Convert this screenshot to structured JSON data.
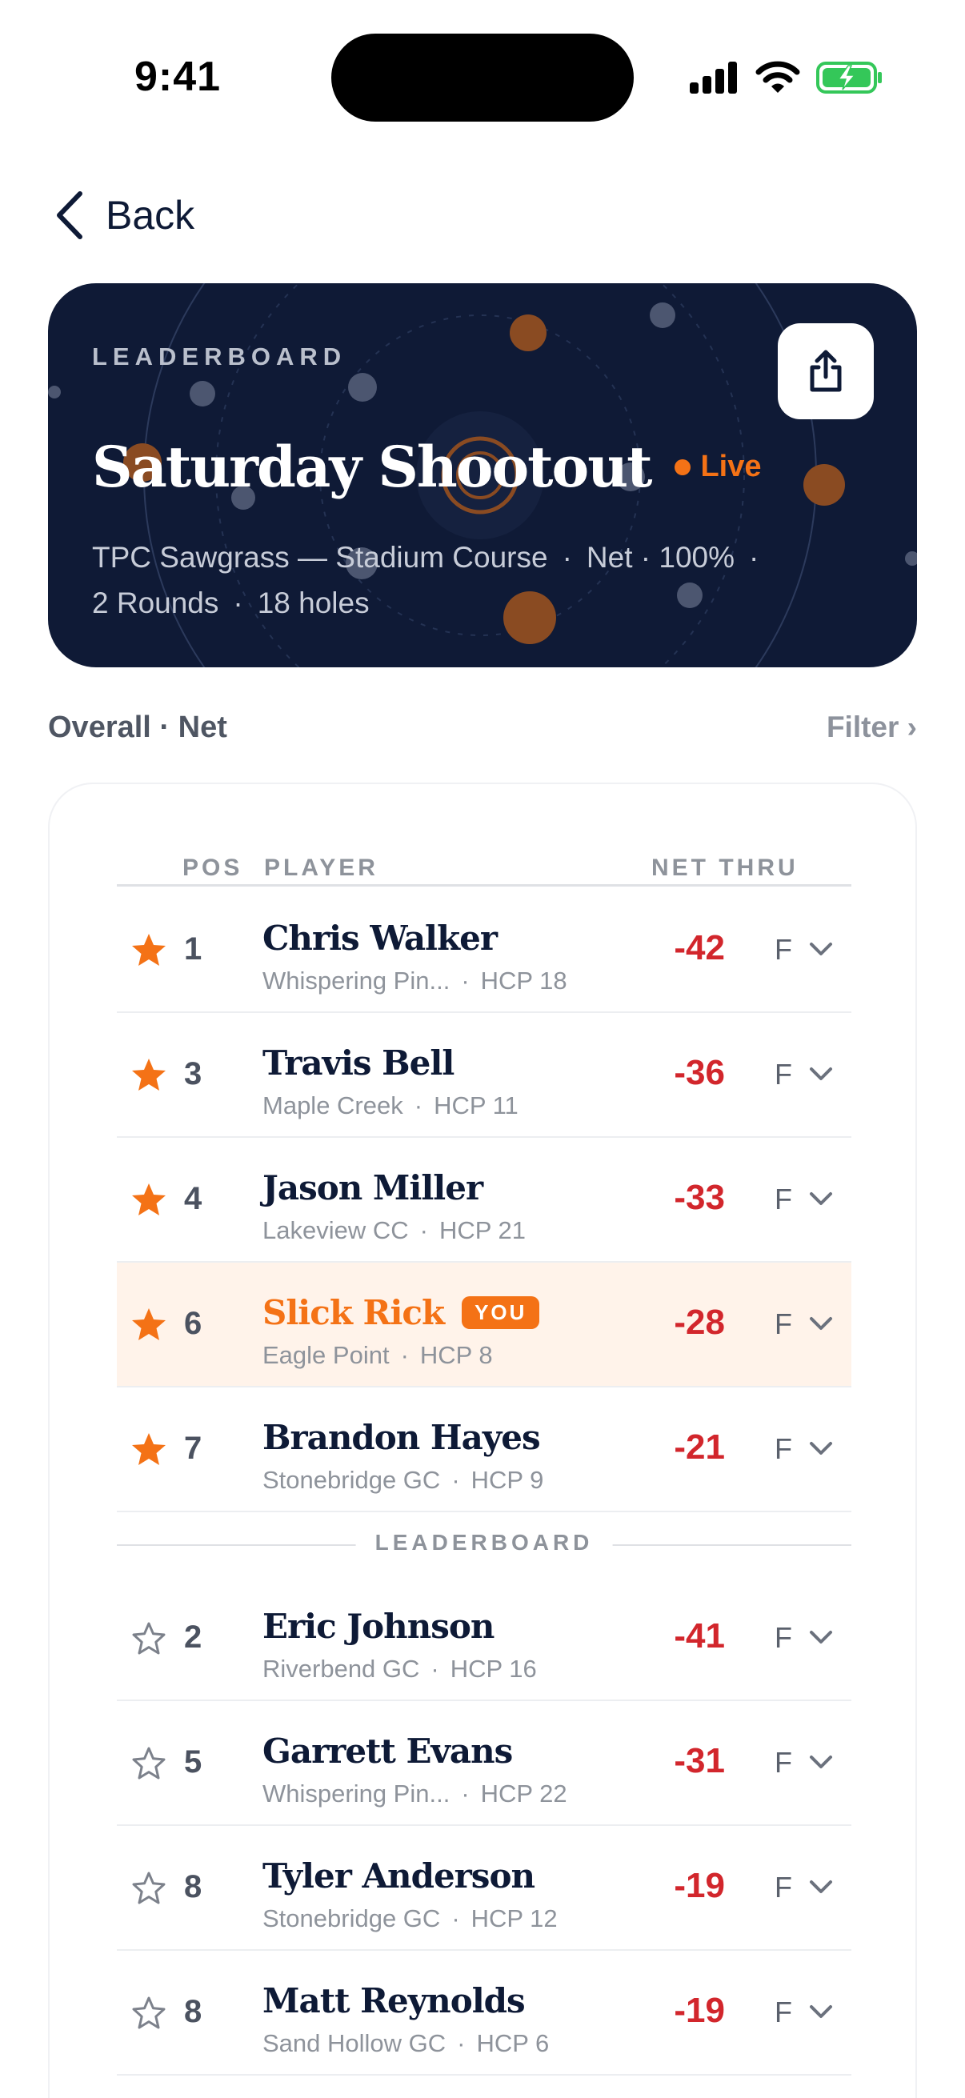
{
  "status_bar": {
    "time": "9:41"
  },
  "nav": {
    "back_label": "Back"
  },
  "hero": {
    "eyebrow": "LEADERBOARD",
    "title": "Saturday Shootout",
    "live_label": "Live",
    "course": "TPC Sawgrass — Stadium Course",
    "scoring": "Net · 100%",
    "rounds": "2 Rounds",
    "holes": "18 holes",
    "meta_separator": "·"
  },
  "section": {
    "title": "Overall · Net",
    "filter_label": "Filter ›"
  },
  "table": {
    "headers": {
      "pos": "POS",
      "player": "PLAYER",
      "net_thru": "NET THRU"
    },
    "divider_label": "LEADERBOARD",
    "you_badge": "YOU",
    "sub_separator": "·",
    "favorites": [
      {
        "pos": "1",
        "name": "Chris Walker",
        "club": "Whispering Pin...",
        "hcp": "HCP 18",
        "net": "-42",
        "thru": "F",
        "starred": true,
        "is_you": false
      },
      {
        "pos": "3",
        "name": "Travis Bell",
        "club": "Maple Creek",
        "hcp": "HCP 11",
        "net": "-36",
        "thru": "F",
        "starred": true,
        "is_you": false
      },
      {
        "pos": "4",
        "name": "Jason Miller",
        "club": "Lakeview CC",
        "hcp": "HCP 21",
        "net": "-33",
        "thru": "F",
        "starred": true,
        "is_you": false
      },
      {
        "pos": "6",
        "name": "Slick Rick",
        "club": "Eagle Point",
        "hcp": "HCP 8",
        "net": "-28",
        "thru": "F",
        "starred": true,
        "is_you": true
      },
      {
        "pos": "7",
        "name": "Brandon Hayes",
        "club": "Stonebridge GC",
        "hcp": "HCP 9",
        "net": "-21",
        "thru": "F",
        "starred": true,
        "is_you": false
      }
    ],
    "leaderboard": [
      {
        "pos": "2",
        "name": "Eric Johnson",
        "club": "Riverbend GC",
        "hcp": "HCP 16",
        "net": "-41",
        "thru": "F",
        "starred": false,
        "is_you": false
      },
      {
        "pos": "5",
        "name": "Garrett Evans",
        "club": "Whispering Pin...",
        "hcp": "HCP 22",
        "net": "-31",
        "thru": "F",
        "starred": false,
        "is_you": false
      },
      {
        "pos": "8",
        "name": "Tyler Anderson",
        "club": "Stonebridge GC",
        "hcp": "HCP 12",
        "net": "-19",
        "thru": "F",
        "starred": false,
        "is_you": false
      },
      {
        "pos": "8",
        "name": "Matt Reynolds",
        "club": "Sand Hollow GC",
        "hcp": "HCP 6",
        "net": "-19",
        "thru": "F",
        "starred": false,
        "is_you": false
      }
    ]
  },
  "colors": {
    "navy": "#0f1a36",
    "accent_orange": "#f47216",
    "score_red": "#d2262c",
    "you_highlight": "#fff3ea"
  }
}
